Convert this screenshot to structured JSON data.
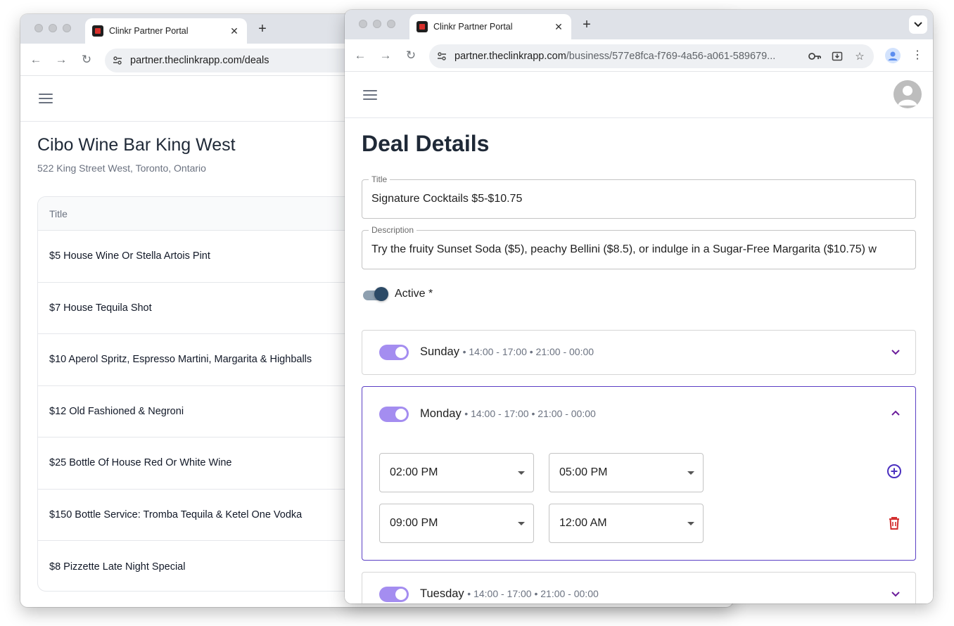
{
  "back_window": {
    "tab_title": "Clinkr Partner Portal",
    "url": "partner.theclinkrapp.com/deals",
    "venue_name": "Cibo Wine Bar King West",
    "venue_address": "522 King Street West, Toronto, Ontario",
    "table_header": "Title",
    "deals": [
      "$5 House Wine Or Stella Artois Pint",
      "$7 House Tequila Shot",
      "$10 Aperol Spritz, Espresso Martini, Margarita & Highballs",
      "$12 Old Fashioned & Negroni",
      "$25 Bottle Of House Red Or White Wine",
      "$150 Bottle Service: Tromba Tequila & Ketel One Vodka",
      "$8 Pizzette Late Night Special"
    ]
  },
  "front_window": {
    "tab_title": "Clinkr Partner Portal",
    "url_host": "partner.theclinkrapp.com",
    "url_path": "/business/577e8fca-f769-4a56-a061-589679...",
    "page_title": "Deal Details",
    "title_field": {
      "label": "Title",
      "value": "Signature Cocktails $5-$10.75"
    },
    "description_field": {
      "label": "Description",
      "value": "Try the fruity Sunset Soda ($5), peachy Bellini ($8.5), or indulge in a Sugar-Free Margarita ($10.75) w"
    },
    "active_label": "Active *",
    "active": true,
    "days": [
      {
        "name": "Sunday",
        "times": "• 14:00 - 17:00 • 21:00 - 00:00",
        "enabled": true,
        "expanded": false
      },
      {
        "name": "Monday",
        "times": "• 14:00 - 17:00 • 21:00 - 00:00",
        "enabled": true,
        "expanded": true,
        "slots": [
          {
            "start": "02:00 PM",
            "end": "05:00 PM",
            "action": "add-circle-icon"
          },
          {
            "start": "09:00 PM",
            "end": "12:00 AM",
            "action": "trash-icon"
          }
        ]
      },
      {
        "name": "Tuesday",
        "times": "• 14:00 - 17:00 • 21:00 - 00:00",
        "enabled": true,
        "expanded": false
      }
    ]
  },
  "colors": {
    "switch_on": "#a48df0",
    "expanded_border": "#5b3fc4",
    "chevron": "#6a1b9a",
    "add_icon": "#4a2fbf",
    "delete_icon": "#d32f2f",
    "active_thumb": "#2c4a66"
  }
}
